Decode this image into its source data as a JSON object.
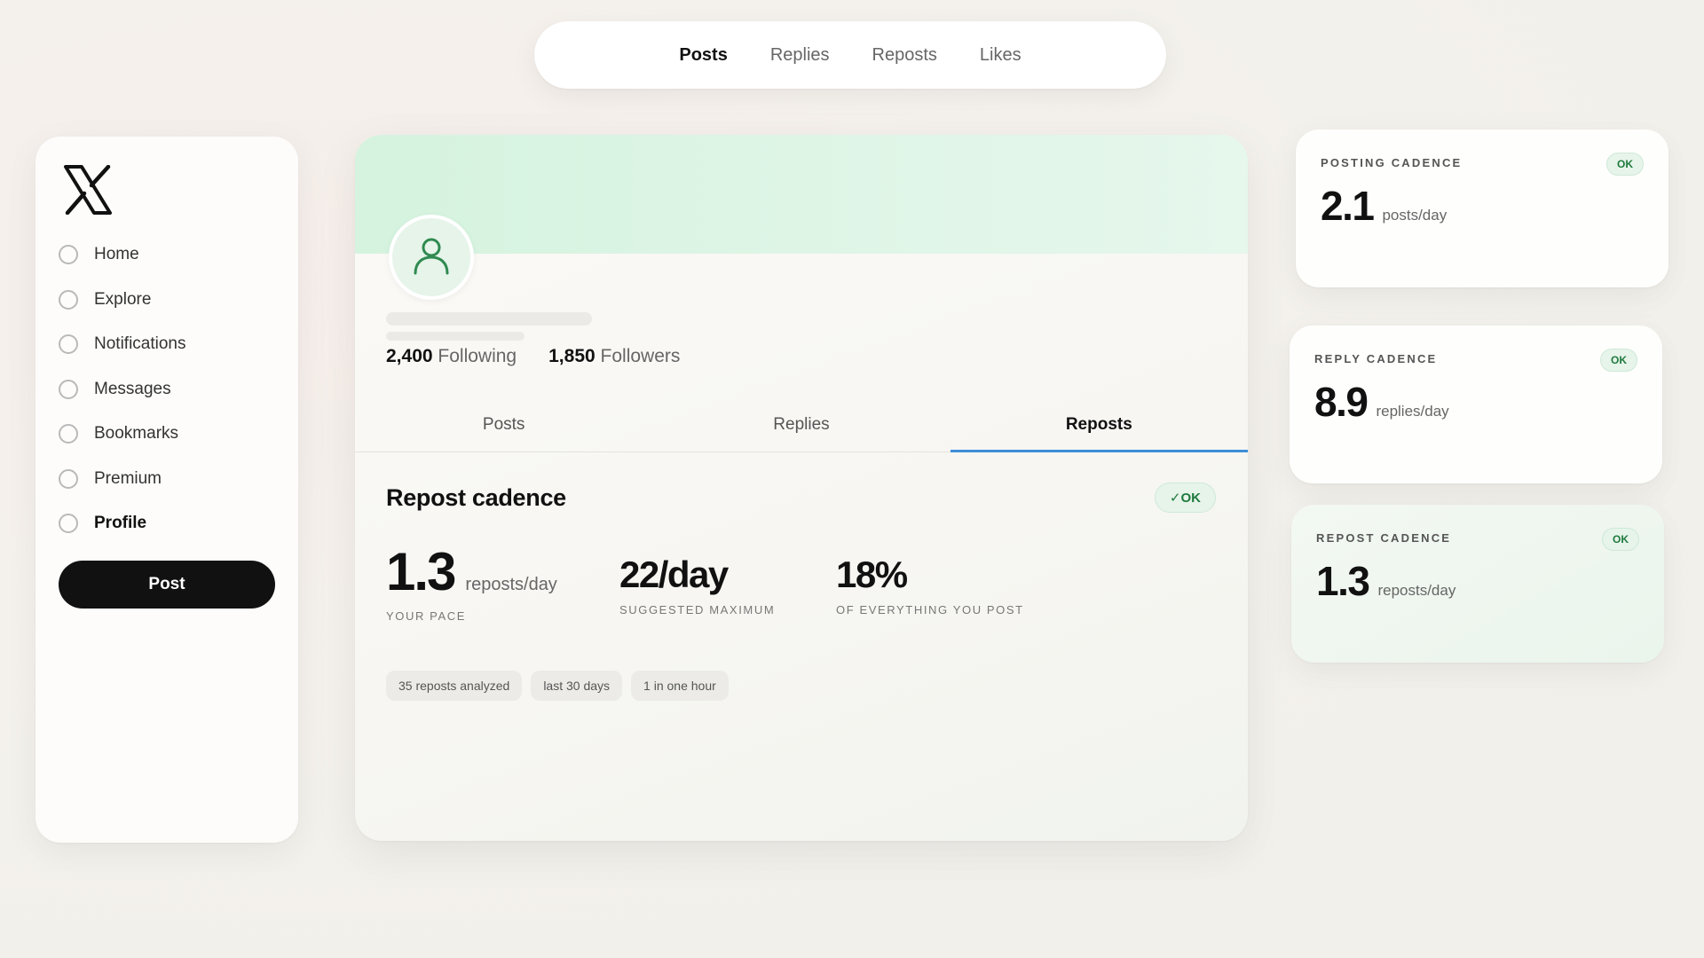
{
  "top_nav": {
    "tabs": [
      {
        "label": "Posts",
        "active": true
      },
      {
        "label": "Replies",
        "active": false
      },
      {
        "label": "Reposts",
        "active": false
      },
      {
        "label": "Likes",
        "active": false
      }
    ]
  },
  "sidebar": {
    "logo_icon": "x-logo-icon",
    "items": [
      {
        "label": "Home"
      },
      {
        "label": "Explore"
      },
      {
        "label": "Notifications"
      },
      {
        "label": "Messages"
      },
      {
        "label": "Bookmarks"
      },
      {
        "label": "Premium"
      },
      {
        "label": "Profile",
        "active": true
      }
    ],
    "post_button": "Post"
  },
  "profile": {
    "following_count": "2,400",
    "following_label": "Following",
    "followers_count": "1,850",
    "followers_label": "Followers",
    "tabs": [
      {
        "label": "Posts"
      },
      {
        "label": "Replies"
      },
      {
        "label": "Reposts",
        "active": true
      }
    ],
    "section": {
      "title": "Repost cadence",
      "badge": "✓OK",
      "metrics": [
        {
          "value": "1.3",
          "unit": "reposts/day",
          "caption": "YOUR PACE"
        },
        {
          "value": "22/day",
          "caption": "SUGGESTED MAXIMUM"
        },
        {
          "value": "18%",
          "caption": "OF EVERYTHING YOU POST"
        }
      ],
      "chips": [
        "35 reposts analyzed",
        "last 30 days",
        "1 in one hour"
      ]
    }
  },
  "cards": [
    {
      "title": "POSTING CADENCE",
      "badge": "OK",
      "value": "2.1",
      "unit": "posts/day"
    },
    {
      "title": "REPLY CADENCE",
      "badge": "OK",
      "value": "8.9",
      "unit": "replies/day"
    },
    {
      "title": "REPOST CADENCE",
      "badge": "OK",
      "value": "1.3",
      "unit": "reposts/day"
    }
  ],
  "colors": {
    "accent_tab_underline": "#3d8fd9",
    "ok_green": "#1f7a3d",
    "banner_green": "#d5f3df"
  }
}
